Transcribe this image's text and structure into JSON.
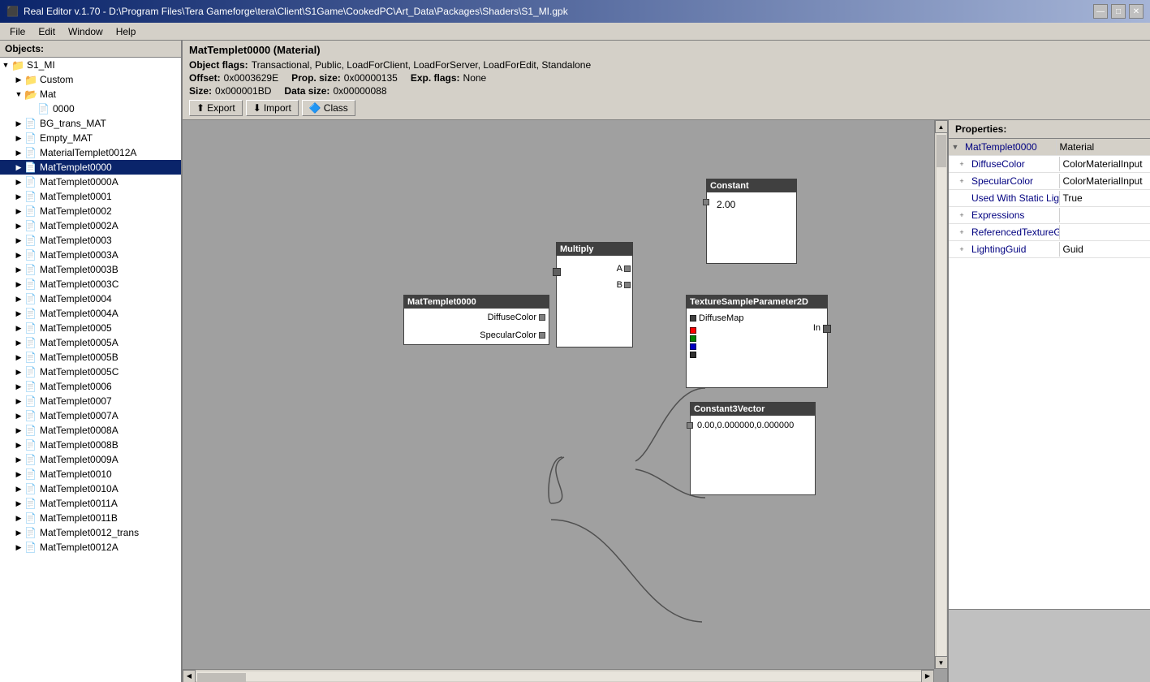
{
  "titlebar": {
    "title": "Real Editor v.1.70 - D:\\Program Files\\Tera Gameforge\\tera\\Client\\S1Game\\CookedPC\\Art_Data\\Packages\\Shaders\\S1_MI.gpk",
    "min": "—",
    "max": "□",
    "close": "✕"
  },
  "menu": {
    "items": [
      "File",
      "Edit",
      "Window",
      "Help"
    ]
  },
  "left_panel": {
    "header": "Objects:",
    "tree": [
      {
        "id": "s1mi",
        "label": "S1_MI",
        "indent": 0,
        "type": "root",
        "expand": "▼"
      },
      {
        "id": "custom",
        "label": "Custom",
        "indent": 1,
        "type": "folder",
        "expand": "▶"
      },
      {
        "id": "mat",
        "label": "Mat",
        "indent": 1,
        "type": "folder",
        "expand": "▼"
      },
      {
        "id": "0000",
        "label": "0000",
        "indent": 2,
        "type": "file",
        "expand": ""
      },
      {
        "id": "bg_trans",
        "label": "BG_trans_MAT",
        "indent": 1,
        "type": "file",
        "expand": "▶"
      },
      {
        "id": "empty_mat",
        "label": "Empty_MAT",
        "indent": 1,
        "type": "file",
        "expand": "▶"
      },
      {
        "id": "mat0012a",
        "label": "MaterialTemplet0012A",
        "indent": 1,
        "type": "file",
        "expand": "▶"
      },
      {
        "id": "mat0000",
        "label": "MatTemplet0000",
        "indent": 1,
        "type": "file_sel",
        "expand": "▶",
        "selected": true
      },
      {
        "id": "mat0000a",
        "label": "MatTemplet0000A",
        "indent": 1,
        "type": "file",
        "expand": "▶"
      },
      {
        "id": "mat0001",
        "label": "MatTemplet0001",
        "indent": 1,
        "type": "file",
        "expand": "▶"
      },
      {
        "id": "mat0002",
        "label": "MatTemplet0002",
        "indent": 1,
        "type": "file",
        "expand": "▶"
      },
      {
        "id": "mat0002a",
        "label": "MatTemplet0002A",
        "indent": 1,
        "type": "file",
        "expand": "▶"
      },
      {
        "id": "mat0003",
        "label": "MatTemplet0003",
        "indent": 1,
        "type": "file",
        "expand": "▶"
      },
      {
        "id": "mat0003a",
        "label": "MatTemplet0003A",
        "indent": 1,
        "type": "file",
        "expand": "▶"
      },
      {
        "id": "mat0003b",
        "label": "MatTemplet0003B",
        "indent": 1,
        "type": "file",
        "expand": "▶"
      },
      {
        "id": "mat0003c",
        "label": "MatTemplet0003C",
        "indent": 1,
        "type": "file",
        "expand": "▶"
      },
      {
        "id": "mat0004",
        "label": "MatTemplet0004",
        "indent": 1,
        "type": "file",
        "expand": "▶"
      },
      {
        "id": "mat0004a",
        "label": "MatTemplet0004A",
        "indent": 1,
        "type": "file",
        "expand": "▶"
      },
      {
        "id": "mat0005",
        "label": "MatTemplet0005",
        "indent": 1,
        "type": "file",
        "expand": "▶"
      },
      {
        "id": "mat0005a",
        "label": "MatTemplet0005A",
        "indent": 1,
        "type": "file",
        "expand": "▶"
      },
      {
        "id": "mat0005b",
        "label": "MatTemplet0005B",
        "indent": 1,
        "type": "file",
        "expand": "▶"
      },
      {
        "id": "mat0005c",
        "label": "MatTemplet0005C",
        "indent": 1,
        "type": "file",
        "expand": "▶"
      },
      {
        "id": "mat0006",
        "label": "MatTemplet0006",
        "indent": 1,
        "type": "file",
        "expand": "▶"
      },
      {
        "id": "mat0007",
        "label": "MatTemplet0007",
        "indent": 1,
        "type": "file",
        "expand": "▶"
      },
      {
        "id": "mat0007a",
        "label": "MatTemplet0007A",
        "indent": 1,
        "type": "file",
        "expand": "▶"
      },
      {
        "id": "mat0008a",
        "label": "MatTemplet0008A",
        "indent": 1,
        "type": "file",
        "expand": "▶"
      },
      {
        "id": "mat0008b",
        "label": "MatTemplet0008B",
        "indent": 1,
        "type": "file",
        "expand": "▶"
      },
      {
        "id": "mat0009a",
        "label": "MatTemplet0009A",
        "indent": 1,
        "type": "file",
        "expand": "▶"
      },
      {
        "id": "mat0010",
        "label": "MatTemplet0010",
        "indent": 1,
        "type": "file",
        "expand": "▶"
      },
      {
        "id": "mat0010a",
        "label": "MatTemplet0010A",
        "indent": 1,
        "type": "file",
        "expand": "▶"
      },
      {
        "id": "mat0011a",
        "label": "MatTemplet0011A",
        "indent": 1,
        "type": "file",
        "expand": "▶"
      },
      {
        "id": "mat0011b",
        "label": "MatTemplet0011B",
        "indent": 1,
        "type": "file",
        "expand": "▶"
      },
      {
        "id": "mat0012_trans",
        "label": "MatTemplet0012_trans",
        "indent": 1,
        "type": "file",
        "expand": "▶"
      },
      {
        "id": "mat0012a_2",
        "label": "MatTemplet0012A",
        "indent": 1,
        "type": "file",
        "expand": "▶"
      }
    ]
  },
  "content": {
    "title": "MatTemplet0000 (Material)",
    "object_flags_label": "Object flags:",
    "object_flags_value": "Transactional, Public, LoadForClient, LoadForServer, LoadForEdit, Standalone",
    "offset_label": "Offset:",
    "offset_value": "0x0003629E",
    "prop_size_label": "Prop. size:",
    "prop_size_value": "0x00000135",
    "exp_flags_label": "Exp. flags:",
    "exp_flags_value": "None",
    "size_label": "Size:",
    "size_value": "0x000001BD",
    "data_size_label": "Data size:",
    "data_size_value": "0x00000088",
    "toolbar": {
      "export_label": "Export",
      "import_label": "Import",
      "class_label": "Class"
    }
  },
  "nodes": {
    "material": {
      "title": "MatTemplet0000",
      "ports": [
        {
          "label": "DiffuseColor",
          "side": "right"
        },
        {
          "label": "SpecularColor",
          "side": "right"
        }
      ]
    },
    "multiply": {
      "title": "Multiply",
      "ports_in": [
        {
          "label": "A",
          "side": "right"
        },
        {
          "label": "B",
          "side": "right"
        }
      ]
    },
    "constant": {
      "title": "Constant",
      "value": "2.00"
    },
    "texture": {
      "title": "TextureSampleParameter2D",
      "ports": [
        {
          "label": "DiffuseMap",
          "color": "black",
          "side": "left"
        },
        {
          "label": "",
          "color": "red",
          "side": "left"
        },
        {
          "label": "",
          "color": "green",
          "side": "left"
        },
        {
          "label": "",
          "color": "blue",
          "side": "left"
        },
        {
          "label": "",
          "color": "black",
          "side": "left"
        }
      ],
      "port_right": "In"
    },
    "constant3": {
      "title": "Constant3Vector",
      "value": "0.00,0.000000,0.000000"
    }
  },
  "properties": {
    "header": "Properties:",
    "items": [
      {
        "name": "MatTemplet0000",
        "value": "Material",
        "expand": "+",
        "indent": 0
      },
      {
        "name": "DiffuseColor",
        "value": "ColorMaterialInput",
        "expand": "+",
        "indent": 1
      },
      {
        "name": "SpecularColor",
        "value": "ColorMaterialInput",
        "expand": "+",
        "indent": 1
      },
      {
        "name": "Used With Static Lig",
        "value": "True",
        "expand": "",
        "indent": 1
      },
      {
        "name": "Expressions",
        "value": "",
        "expand": "+",
        "indent": 1
      },
      {
        "name": "ReferencedTextureGuids",
        "value": "",
        "expand": "+",
        "indent": 1
      },
      {
        "name": "LightingGuid",
        "value": "Guid",
        "expand": "+",
        "indent": 1
      }
    ]
  }
}
